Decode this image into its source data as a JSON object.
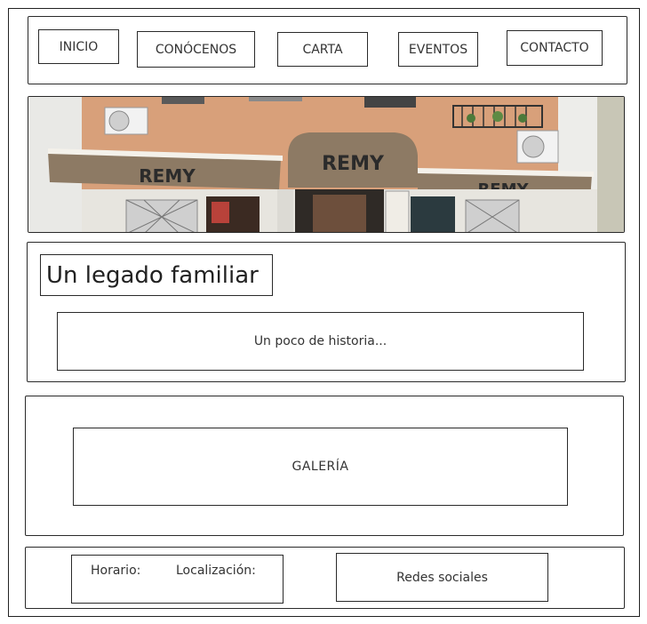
{
  "nav": {
    "items": [
      {
        "label": "INICIO"
      },
      {
        "label": "CONÓCENOS"
      },
      {
        "label": "CARTA"
      },
      {
        "label": "EVENTOS"
      },
      {
        "label": "CONTACTO"
      }
    ]
  },
  "hero": {
    "sign_center": "REMY",
    "sign_left": "REMY",
    "sign_right": "REMY"
  },
  "about": {
    "title": "Un legado familiar",
    "history_label": "Un poco de historia..."
  },
  "gallery": {
    "label": "GALERÍA"
  },
  "footer": {
    "schedule_label": "Horario:",
    "location_label": "Localización:",
    "social_label": "Redes sociales"
  }
}
